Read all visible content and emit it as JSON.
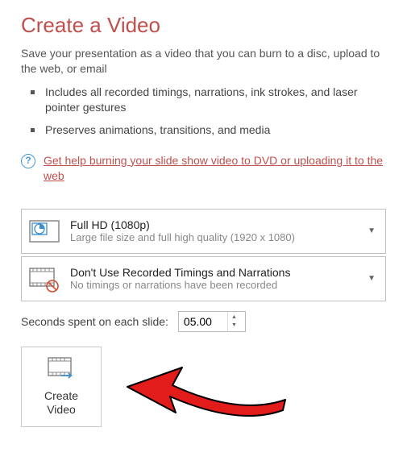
{
  "title": "Create a Video",
  "intro": "Save your presentation as a video that you can burn to a disc, upload to the web, or email",
  "bullets": [
    "Includes all recorded timings, narrations, ink strokes, and laser pointer gestures",
    "Preserves animations, transitions, and media"
  ],
  "help": {
    "icon": "?",
    "link_text": "Get help burning your slide show video to DVD or uploading it to the web"
  },
  "quality": {
    "title": "Full HD (1080p)",
    "sub": "Large file size and full high quality (1920 x 1080)"
  },
  "timings": {
    "title": "Don't Use Recorded Timings and Narrations",
    "sub": "No timings or narrations have been recorded"
  },
  "seconds": {
    "label": "Seconds spent on each slide:",
    "value": "05.00"
  },
  "create_button": "Create\nVideo"
}
